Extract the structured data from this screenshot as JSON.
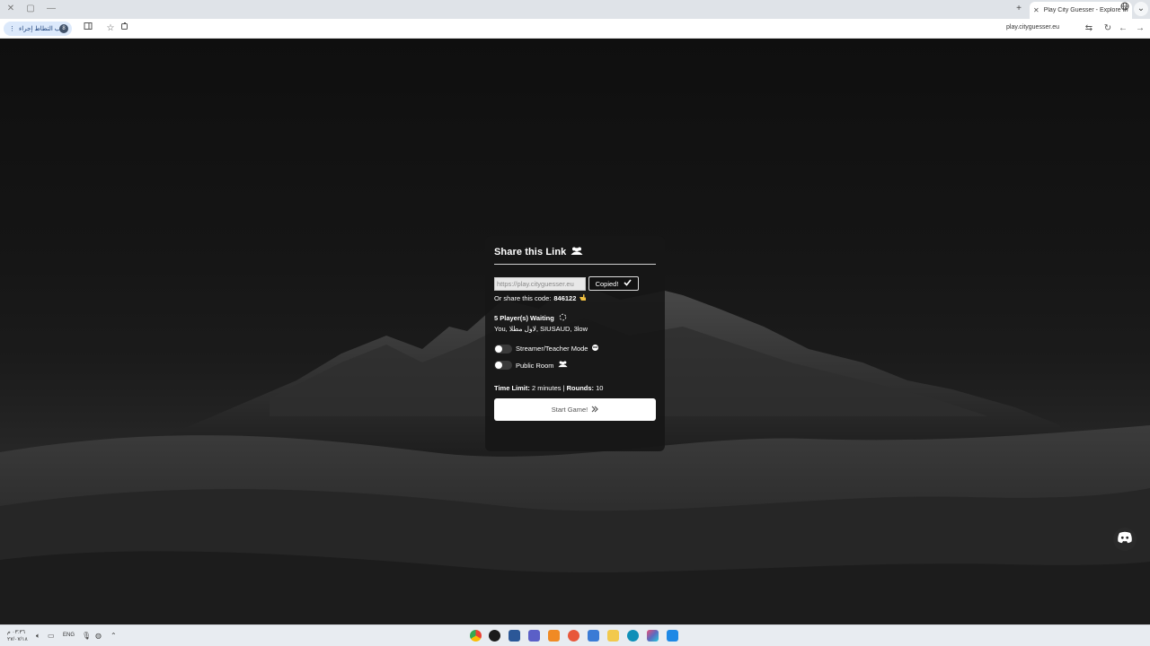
{
  "browser": {
    "tab_title": "Play City Guesser - Explore the",
    "toolbar_chip_label": "جيب التطاط إجراء",
    "profile_initial": "8",
    "url": "play.cityguesser.eu"
  },
  "modal": {
    "title": "Share this Link",
    "link_value": "https://play.cityguesser.eu",
    "copied_label": "Copied!",
    "code_prefix": "Or share this code:",
    "code": "846122",
    "waiting_label": "5 Player(s) Waiting",
    "players": "You, لاول مطلا, SIUSAUD, 3low",
    "streamer_label": "Streamer/Teacher Mode",
    "public_label": "Public Room",
    "time_limit_label": "Time Limit:",
    "time_limit_value": "2 minutes |",
    "rounds_label": "Rounds:",
    "rounds_value": "10",
    "start_label": "Start Game!"
  },
  "taskbar": {
    "time": "٠٣:٣٦ م",
    "date": "٢٧/٠٧/١٨",
    "lang": "ENG"
  },
  "colors": {
    "modal_bg": "#161616",
    "accent_white": "#ffffff",
    "page_bg": "#111111"
  }
}
